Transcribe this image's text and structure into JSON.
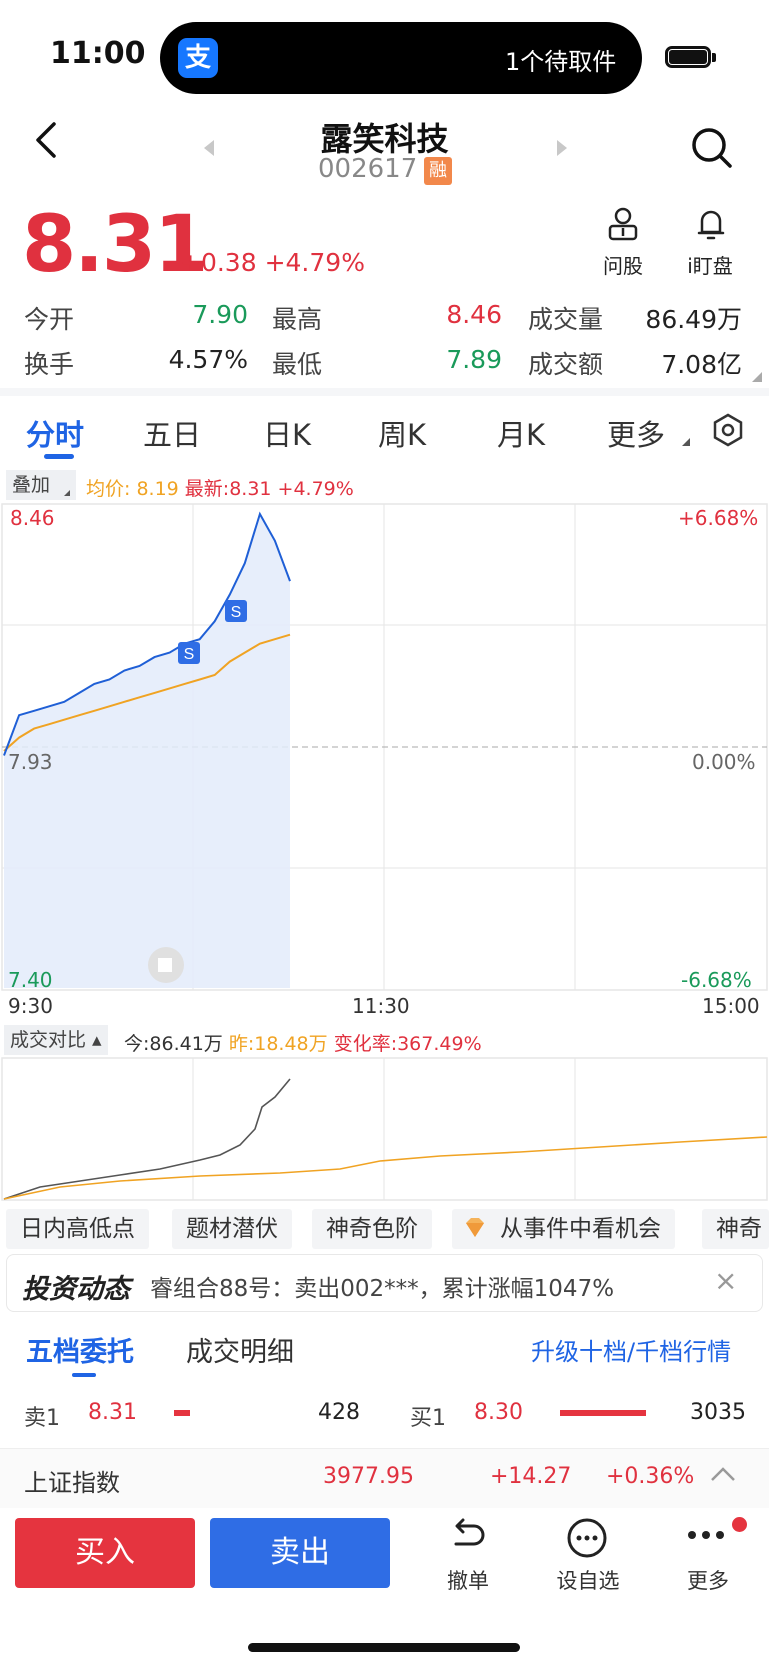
{
  "status_bar": {
    "time": "11:00",
    "app_icon_char": "支",
    "notification": "1个待取件"
  },
  "header": {
    "title": "露笑科技",
    "code": "002617",
    "badge": "融"
  },
  "quote": {
    "price": "8.31",
    "change": "+0.38",
    "change_pct": "+4.79%",
    "ask_label": "问股",
    "watch_label": "i盯盘"
  },
  "stats": [
    {
      "label": "今开",
      "value": "7.90",
      "color": "green"
    },
    {
      "label": "最高",
      "value": "8.46",
      "color": "red"
    },
    {
      "label": "成交量",
      "value": "86.49万",
      "color": "black"
    },
    {
      "label": "换手",
      "value": "4.57%",
      "color": "black"
    },
    {
      "label": "最低",
      "value": "7.89",
      "color": "green"
    },
    {
      "label": "成交额",
      "value": "7.08亿",
      "color": "black"
    }
  ],
  "tabs": [
    "分时",
    "五日",
    "日K",
    "周K",
    "月K",
    "更多"
  ],
  "chart": {
    "overlay_label": "叠加",
    "avg_label": "均价: 8.19",
    "latest_label": "最新:8.31 +4.79%",
    "y_high": "8.46",
    "y_mid": "7.93",
    "y_low": "7.40",
    "pct_high": "+6.68%",
    "pct_mid": "0.00%",
    "pct_low": "-6.68%",
    "x_start": "9:30",
    "x_mid": "11:30",
    "x_end": "15:00",
    "marker": "S"
  },
  "chart_data": {
    "type": "line",
    "x_range": [
      "9:30",
      "15:00"
    ],
    "ylim": [
      7.4,
      8.46
    ],
    "series": [
      {
        "name": "最新",
        "color": "#1f5fd6",
        "values": [
          7.92,
          8.01,
          8.02,
          8.03,
          8.04,
          8.06,
          8.08,
          8.09,
          8.11,
          8.12,
          8.14,
          8.15,
          8.17,
          8.18,
          8.22,
          8.28,
          8.35,
          8.46,
          8.4,
          8.31
        ]
      },
      {
        "name": "均价",
        "color": "#f0a323",
        "values": [
          7.93,
          7.96,
          7.98,
          7.99,
          8.0,
          8.01,
          8.02,
          8.03,
          8.04,
          8.05,
          8.06,
          8.07,
          8.08,
          8.09,
          8.1,
          8.13,
          8.15,
          8.17,
          8.18,
          8.19
        ]
      }
    ]
  },
  "volume_compare": {
    "label": "成交对比",
    "today": "今:86.41万",
    "yesterday": "昨:18.48万",
    "ratio": "变化率:367.49%"
  },
  "chips": [
    "日内高低点",
    "题材潜伏",
    "神奇色阶",
    "从事件中看机会",
    "神奇"
  ],
  "news": {
    "tag": "投资动态",
    "text": "睿组合88号：卖出002***，累计涨幅1047%",
    "close": "×"
  },
  "order_book": {
    "tab_active": "五档委托",
    "tab_other": "成交明细",
    "link": "升级十档/千档行情",
    "sell1": {
      "label": "卖1",
      "price": "8.31",
      "volume": "428"
    },
    "buy1": {
      "label": "买1",
      "price": "8.30",
      "volume": "3035"
    }
  },
  "index_bar": {
    "name": "上证指数",
    "value": "3977.95",
    "change": "+14.27",
    "change_pct": "+0.36%"
  },
  "bottom": {
    "buy": "买入",
    "sell": "卖出",
    "cancel": "撤单",
    "watchlist": "设自选",
    "more": "更多"
  }
}
